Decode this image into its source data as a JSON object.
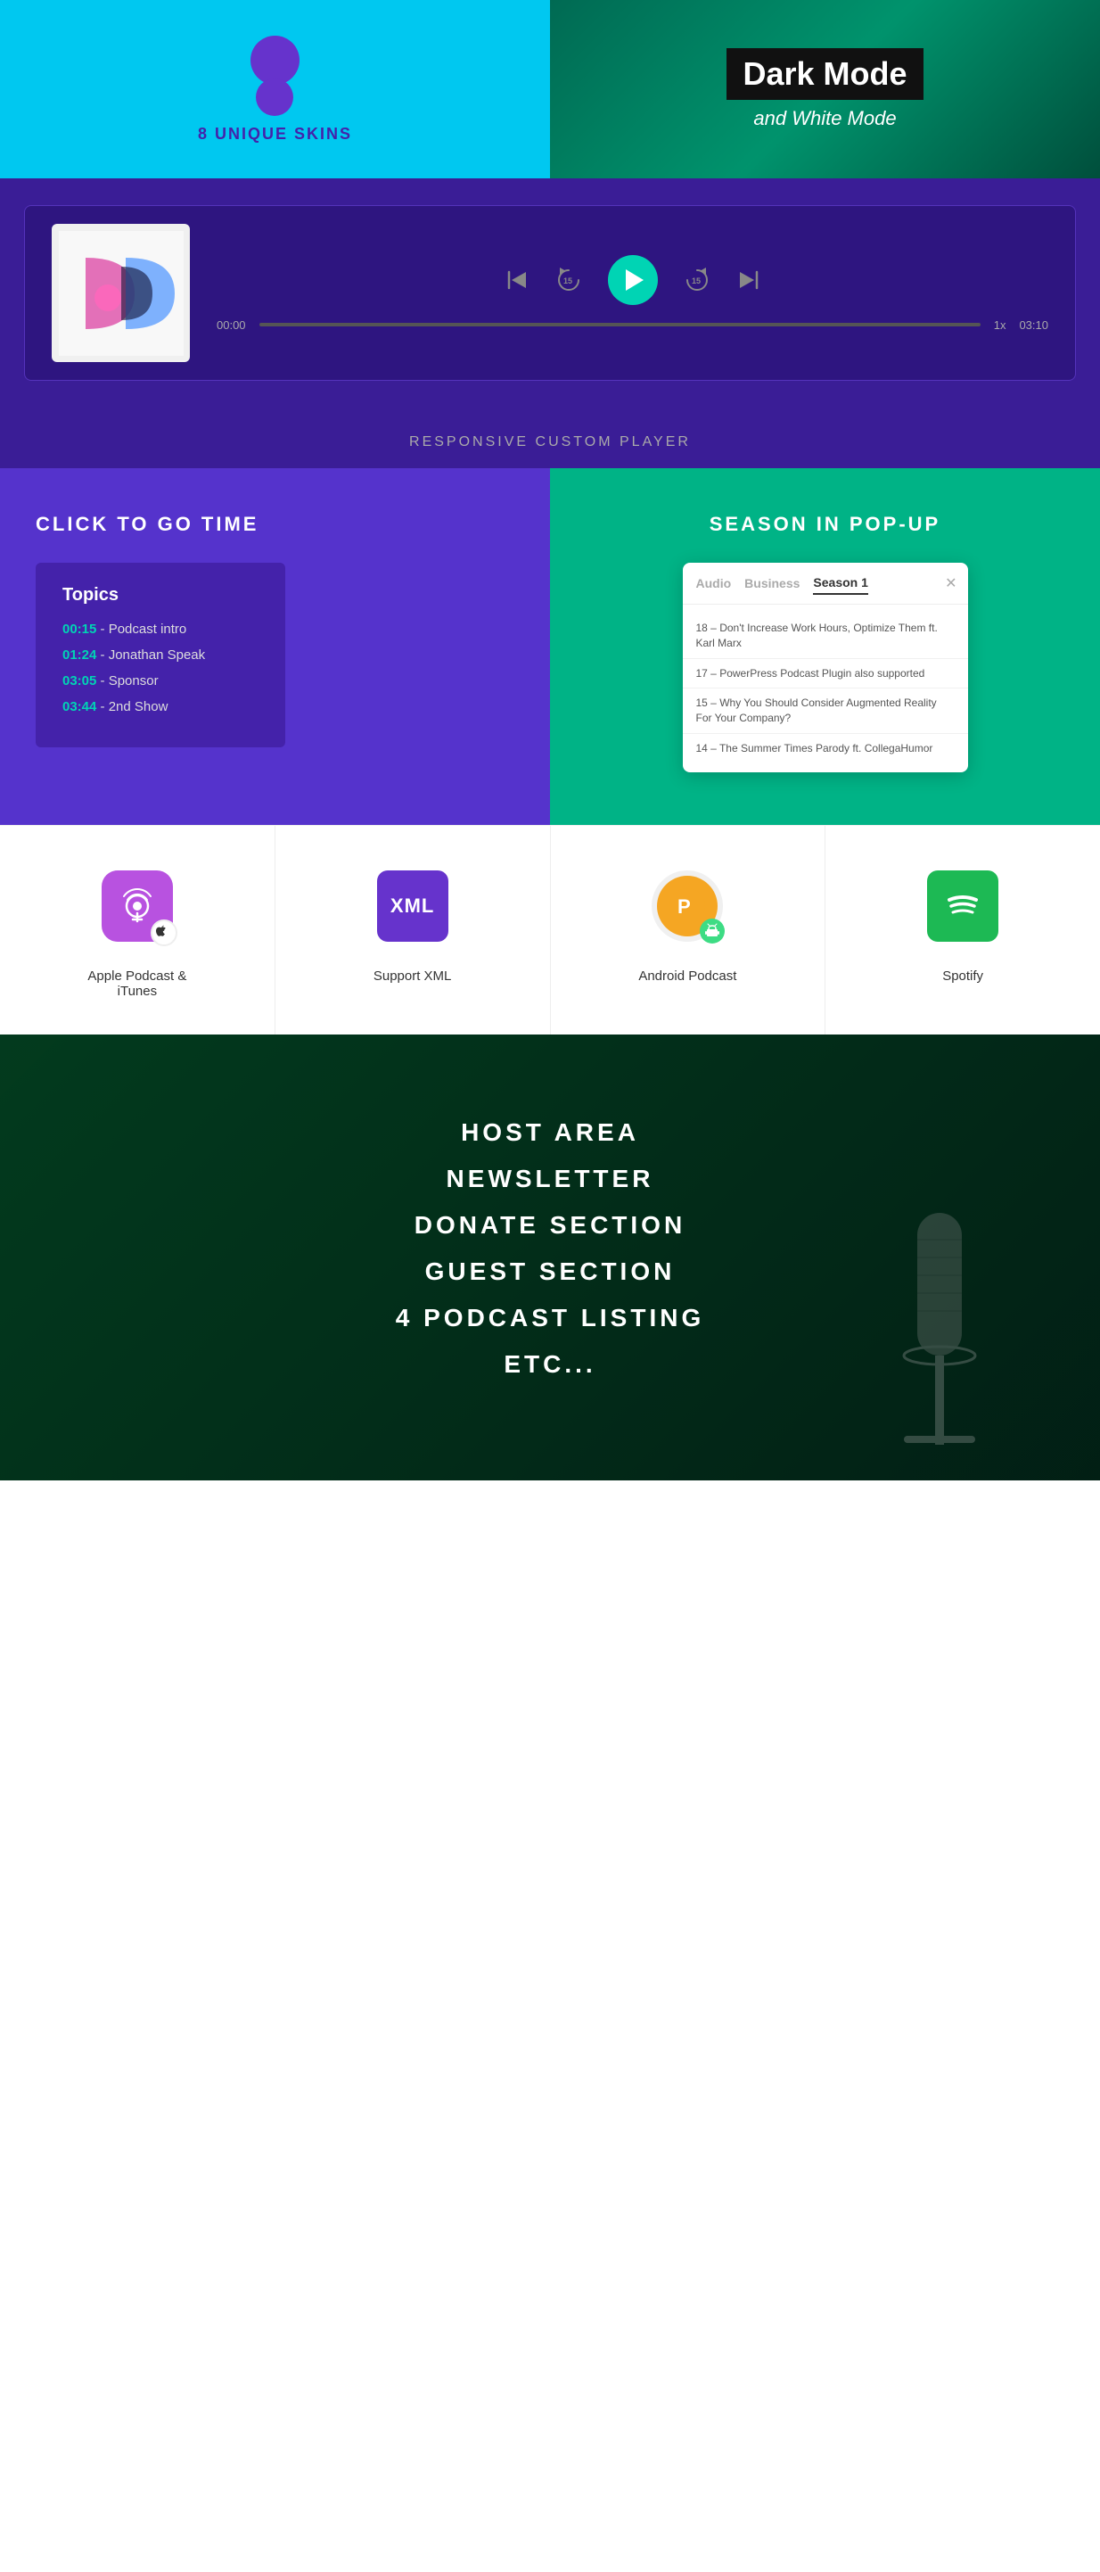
{
  "hero": {
    "left": {
      "title": "8 UNIQUE SKINS"
    },
    "right": {
      "dark_mode": "Dark Mode",
      "white_mode": "and White Mode"
    }
  },
  "player": {
    "time_start": "00:00",
    "time_end": "03:10",
    "speed": "1x",
    "label": "RESPONSIVE CUSTOM PLAYER",
    "rewind_label": "15",
    "forward_label": "15"
  },
  "click_to_go": {
    "title": "CLICK TO GO TIME",
    "topics_label": "Topics",
    "items": [
      {
        "time": "00:15",
        "desc": "- Podcast intro"
      },
      {
        "time": "01:24",
        "desc": "- Jonathan Speak"
      },
      {
        "time": "03:05",
        "desc": "- Sponsor"
      },
      {
        "time": "03:44",
        "desc": "- 2nd Show"
      }
    ]
  },
  "season_popup": {
    "title": "SEASON IN POP-UP",
    "tabs": [
      "Audio",
      "Business",
      "Season 1"
    ],
    "active_tab": "Season 1",
    "list_items": [
      "18 – Don't Increase Work Hours, Optimize Them ft. Karl Marx",
      "17 – PowerPress Podcast Plugin also supported",
      "15 – Why You Should Consider Augmented Reality For Your Company?",
      "14 – The Summer Times Parody ft. CollegaHumor"
    ]
  },
  "platforms": [
    {
      "name": "apple-podcast",
      "label": "Apple Podcast &\niTunes"
    },
    {
      "name": "support-xml",
      "label": "Support XML"
    },
    {
      "name": "android-podcast",
      "label": "Android Podcast"
    },
    {
      "name": "spotify",
      "label": "Spotify"
    }
  ],
  "features_list": {
    "items": [
      "HOST AREA",
      "NEWSLETTER",
      "DONATE SECTION",
      "GUEST SECTION",
      "4 PODCAST LISTING",
      "ETC..."
    ]
  }
}
